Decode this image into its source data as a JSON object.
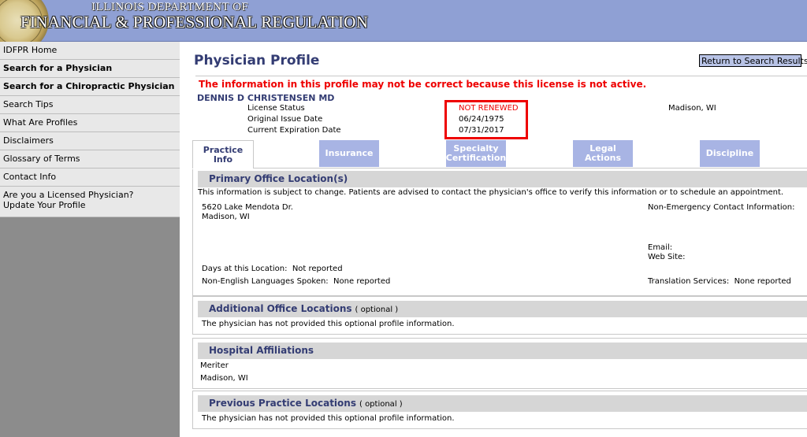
{
  "header": {
    "line1": "ILLINOIS DEPARTMENT OF",
    "line2": "FINANCIAL & PROFESSIONAL REGULATION"
  },
  "sidebar": {
    "items": [
      {
        "label": "IDFPR Home"
      },
      {
        "label": "Search for a Physician"
      },
      {
        "label": "Search for a Chiropractic Physician"
      },
      {
        "label": "Search Tips"
      },
      {
        "label": "What Are Profiles"
      },
      {
        "label": "Disclaimers"
      },
      {
        "label": "Glossary of Terms"
      },
      {
        "label": "Contact Info"
      },
      {
        "label": "Are you a Licensed Physician?",
        "label2": "Update Your Profile"
      }
    ]
  },
  "main": {
    "title": "Physician Profile",
    "return_button": "Return to Search Results",
    "warning": "The information in this profile may not be correct because this license is not active.",
    "physician_name": "DENNIS D CHRISTENSEN MD",
    "license": {
      "status_label": "License Status",
      "status_value": "NOT RENEWED",
      "issue_label": "Original Issue Date",
      "issue_value": "06/24/1975",
      "expiration_label": "Current Expiration Date",
      "expiration_value": "07/31/2017",
      "location": "Madison, WI"
    },
    "tabs": [
      {
        "line1": "Practice",
        "line2": "Info"
      },
      {
        "line1": "Insurance",
        "line2": ""
      },
      {
        "line1": "Specialty",
        "line2": "Certification"
      },
      {
        "line1": "Legal",
        "line2": "Actions"
      },
      {
        "line1": "Discipline",
        "line2": ""
      }
    ],
    "primary_office": {
      "title": "Primary Office Location(s)",
      "notice": "This information is subject to change. Patients are advised to contact the physician's office to verify this information or to schedule an appointment.",
      "address1": "5620 Lake Mendota Dr.",
      "address2": "Madison, WI",
      "contact_label": "Non-Emergency Contact Information:",
      "email_label": "Email:",
      "website_label": "Web Site:",
      "days_label": "Days at this Location:",
      "days_value": "Not reported",
      "languages_label": "Non-English Languages Spoken:",
      "languages_value": "None reported",
      "translation_label": "Translation Services:",
      "translation_value": "None reported"
    },
    "additional_office": {
      "title": "Additional Office Locations",
      "optional": "( optional )",
      "text": "The physician has not provided this optional profile information."
    },
    "hospital": {
      "title": "Hospital Affiliations",
      "name": "Meriter",
      "city": "Madison, WI"
    },
    "previous_practice": {
      "title": "Previous Practice Locations",
      "optional": "( optional )",
      "text": "The physician has not provided this optional profile information."
    }
  }
}
